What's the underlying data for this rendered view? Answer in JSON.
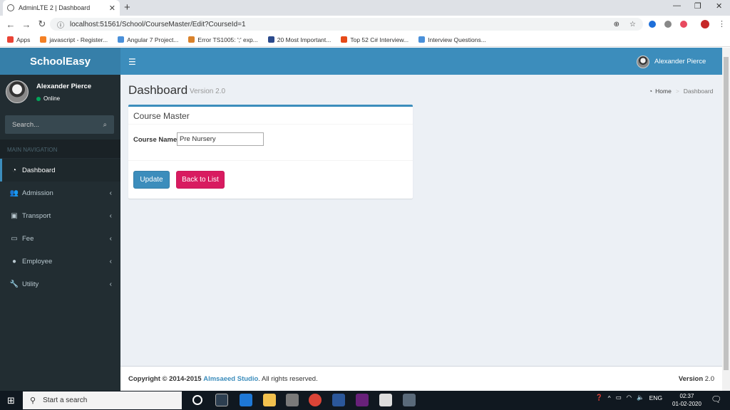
{
  "browser": {
    "tab_title": "AdminLTE 2 | Dashboard",
    "tab_close": "✕",
    "new_tab": "+",
    "url": "localhost:51561/School/CourseMaster/Edit?CourseId=1",
    "bookmarks": [
      {
        "label": "Apps",
        "icon": "apps-grid-icon",
        "color": "#ea4335"
      },
      {
        "label": "javascript - Register...",
        "icon": "stackoverflow-icon",
        "color": "#f48024"
      },
      {
        "label": "Angular 7 Project...",
        "icon": "code-icon",
        "color": "#4a90d9"
      },
      {
        "label": "Error TS1005: ';' exp...",
        "icon": "page-icon",
        "color": "#d9822b"
      },
      {
        "label": "20 Most Important...",
        "icon": "h-icon",
        "color": "#2b4a8c"
      },
      {
        "label": "Top 52 C# Interview...",
        "icon": "circle-icon",
        "color": "#e64a19"
      },
      {
        "label": "Interview Questions...",
        "icon": "code-icon",
        "color": "#4a90d9"
      }
    ]
  },
  "app": {
    "logo": "SchoolEasy",
    "user_name": "Alexander Pierce",
    "user_status": "Online",
    "search_placeholder": "Search...",
    "nav_header": "MAIN NAVIGATION",
    "menu": [
      {
        "label": "Dashboard",
        "icon": "dashboard-icon",
        "glyph": "◔",
        "active": true
      },
      {
        "label": "Admission",
        "icon": "users-icon",
        "glyph": "👥",
        "active": false
      },
      {
        "label": "Transport",
        "icon": "bus-icon",
        "glyph": "▣",
        "active": false
      },
      {
        "label": "Fee",
        "icon": "money-icon",
        "glyph": "▭",
        "active": false
      },
      {
        "label": "Employee",
        "icon": "user-icon",
        "glyph": "●",
        "active": false
      },
      {
        "label": "Utility",
        "icon": "wrench-icon",
        "glyph": "🔧",
        "active": false
      }
    ]
  },
  "page": {
    "title": "Dashboard",
    "subtitle": "Version 2.0",
    "breadcrumb_home": "Home",
    "breadcrumb_current": "Dashboard",
    "box_title": "Course Master",
    "course_name_label": "Course Name",
    "course_name_value": "Pre Nursery",
    "update_button": "Update",
    "back_button": "Back to List"
  },
  "footer": {
    "copyright_prefix": "Copyright © 2014-2015",
    "company": "Almsaeed Studio",
    "rights": ". All rights reserved.",
    "version_label": "Version",
    "version_value": "2.0"
  },
  "taskbar": {
    "search_placeholder": "Start a search",
    "language": "ENG",
    "time": "02:37",
    "date": "01-02-2020",
    "notifications": "2"
  },
  "colors": {
    "header": "#3c8dbc",
    "logo_bg": "#367fa9",
    "sidebar": "#222d32",
    "back_button": "#d81b60"
  }
}
